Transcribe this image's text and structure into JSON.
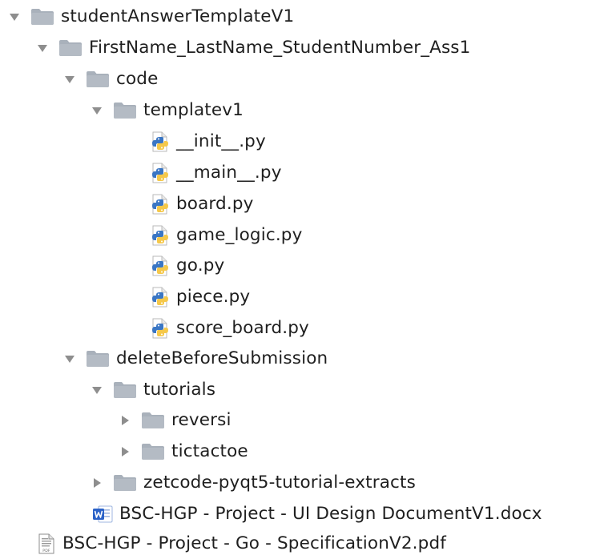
{
  "colors": {
    "folder": "#a9b1bb",
    "arrow": "#8e8e8e",
    "text": "#1f1f1f",
    "python_blue": "#3a76c4",
    "python_yellow": "#f5c84a",
    "word_blue": "#2b62c8",
    "pdf_gray": "#6b6b6b"
  },
  "tree": {
    "root": {
      "label": "studentAnswerTemplateV1",
      "icon": "folder-icon",
      "expanded": true
    },
    "project": {
      "label": "FirstName_LastName_StudentNumber_Ass1",
      "icon": "folder-icon",
      "expanded": true
    },
    "code": {
      "label": "code",
      "icon": "folder-icon",
      "expanded": true
    },
    "templatev1": {
      "label": "templatev1",
      "icon": "folder-icon",
      "expanded": true
    },
    "files": [
      {
        "label": "__init__.py",
        "icon": "python-file-icon"
      },
      {
        "label": "__main__.py",
        "icon": "python-file-icon"
      },
      {
        "label": "board.py",
        "icon": "python-file-icon"
      },
      {
        "label": "game_logic.py",
        "icon": "python-file-icon"
      },
      {
        "label": "go.py",
        "icon": "python-file-icon"
      },
      {
        "label": "piece.py",
        "icon": "python-file-icon"
      },
      {
        "label": "score_board.py",
        "icon": "python-file-icon"
      }
    ],
    "deleteBeforeSubmission": {
      "label": "deleteBeforeSubmission",
      "icon": "folder-icon",
      "expanded": true
    },
    "tutorials": {
      "label": "tutorials",
      "icon": "folder-icon",
      "expanded": true
    },
    "reversi": {
      "label": "reversi",
      "icon": "folder-icon",
      "expanded": false
    },
    "tictactoe": {
      "label": "tictactoe",
      "icon": "folder-icon",
      "expanded": false
    },
    "zetcode": {
      "label": "zetcode-pyqt5-tutorial-extracts",
      "icon": "folder-icon",
      "expanded": false
    },
    "ui_doc": {
      "label": "BSC-HGP - Project - UI Design DocumentV1.docx",
      "icon": "word-file-icon"
    },
    "spec_pdf": {
      "label": "BSC-HGP - Project - Go - SpecificationV2.pdf",
      "icon": "pdf-file-icon"
    }
  }
}
